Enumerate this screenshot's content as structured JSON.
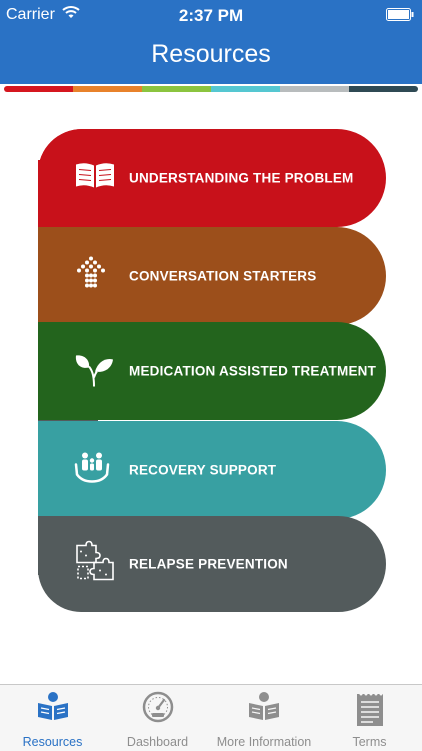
{
  "status_bar": {
    "carrier": "Carrier",
    "time": "2:37 PM"
  },
  "header": {
    "title": "Resources"
  },
  "colors": {
    "header": "#2a72c5",
    "strip": [
      "#d5161f",
      "#e8822b",
      "#8bc43f",
      "#55c7d1",
      "#b8bcbd",
      "#2f4a54"
    ],
    "spine": "#c8111a"
  },
  "menu": {
    "items": [
      {
        "label": "UNDERSTANDING  THE PROBLEM",
        "icon": "open-book-icon",
        "color": "#c8111a"
      },
      {
        "label": "CONVERSATION STARTERS",
        "icon": "arrow-up-icon",
        "color": "#9c4f1b"
      },
      {
        "label": "MEDICATION ASSISTED TREATMENT",
        "icon": "leaves-icon",
        "color": "#23641d"
      },
      {
        "label": "RECOVERY SUPPORT",
        "icon": "family-hands-icon",
        "color": "#38a0a2"
      },
      {
        "label": "RELAPSE PREVENTION",
        "icon": "puzzle-icon",
        "color": "#535b5c"
      }
    ]
  },
  "tabbar": {
    "tabs": [
      {
        "label": "Resources",
        "icon": "book-reader-icon",
        "active": true
      },
      {
        "label": "Dashboard",
        "icon": "speedometer-icon",
        "active": false
      },
      {
        "label": "More Information",
        "icon": "book-reader-icon",
        "active": false
      },
      {
        "label": "Terms",
        "icon": "notepad-icon",
        "active": false
      }
    ]
  }
}
